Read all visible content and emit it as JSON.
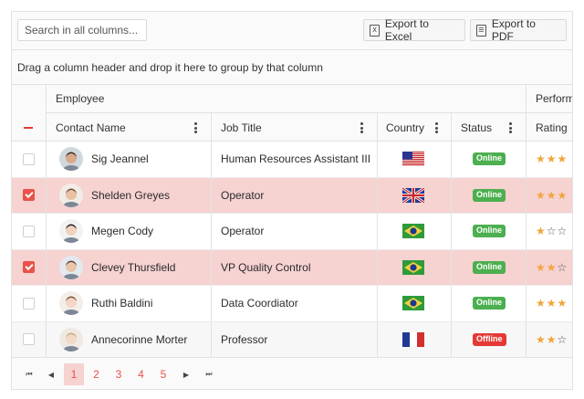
{
  "toolbar": {
    "search_placeholder": "Search in all columns...",
    "export_excel_label": "Export to Excel",
    "export_pdf_label": "Export to PDF",
    "excel_icon_glyph": "X",
    "pdf_icon_glyph": "☰"
  },
  "group_panel": {
    "text": "Drag a column header and drop it here to group by that column"
  },
  "header": {
    "group_employee": "Employee",
    "group_performance": "Perform",
    "columns": {
      "contact_name": "Contact Name",
      "job_title": "Job Title",
      "country": "Country",
      "status": "Status",
      "rating": "Rating"
    }
  },
  "rows": [
    {
      "selected": false,
      "name": "Sig Jeannel",
      "job": "Human Resources Assistant III",
      "country": "US",
      "status": "Online",
      "rating": 3,
      "avatar": {
        "skin": "#d9a98c",
        "hair": "#3b2a20",
        "bg": "#cfd8dc"
      }
    },
    {
      "selected": true,
      "name": "Shelden Greyes",
      "job": "Operator",
      "country": "GB",
      "status": "Online",
      "rating": 3,
      "avatar": {
        "skin": "#e8c2a3",
        "hair": "#6d4c33",
        "bg": "#f2ece6"
      }
    },
    {
      "selected": false,
      "name": "Megen Cody",
      "job": "Operator",
      "country": "BR",
      "status": "Online",
      "rating": 1,
      "avatar": {
        "skin": "#f0d2bd",
        "hair": "#1e1a18",
        "bg": "#f2f2f2"
      }
    },
    {
      "selected": true,
      "name": "Clevey Thursfield",
      "job": "VP Quality Control",
      "country": "BR",
      "status": "Online",
      "rating": 2,
      "avatar": {
        "skin": "#e9c6a9",
        "hair": "#5a4030",
        "bg": "#e3e9ef"
      }
    },
    {
      "selected": false,
      "name": "Ruthi Baldini",
      "job": "Data Coordiator",
      "country": "BR",
      "status": "Online",
      "rating": 3,
      "avatar": {
        "skin": "#f2d6c6",
        "hair": "#7a4d34",
        "bg": "#f4eee9"
      }
    },
    {
      "selected": false,
      "name": "Annecorinne Morter",
      "job": "Professor",
      "country": "FR",
      "status": "Offline",
      "rating": 2,
      "avatar": {
        "skin": "#f1d9c7",
        "hair": "#c9a77c",
        "bg": "#efe9e2"
      }
    }
  ],
  "pager": {
    "first_glyph": "⏮",
    "prev_glyph": "◀",
    "next_glyph": "▶",
    "last_glyph": "⏭",
    "pages": [
      "1",
      "2",
      "3",
      "4",
      "5"
    ],
    "current_page": "1"
  },
  "colors": {
    "accent": "#e8524a",
    "selected_row": "#f6d2d1",
    "online": "#4caf50",
    "offline": "#e53935",
    "star": "#f0a53a"
  },
  "icons": {
    "excel": "excel-file-icon",
    "pdf": "pdf-file-icon",
    "column_menu": "column-menu-icon",
    "deselect": "deselect-all-icon",
    "star": "star-icon"
  }
}
